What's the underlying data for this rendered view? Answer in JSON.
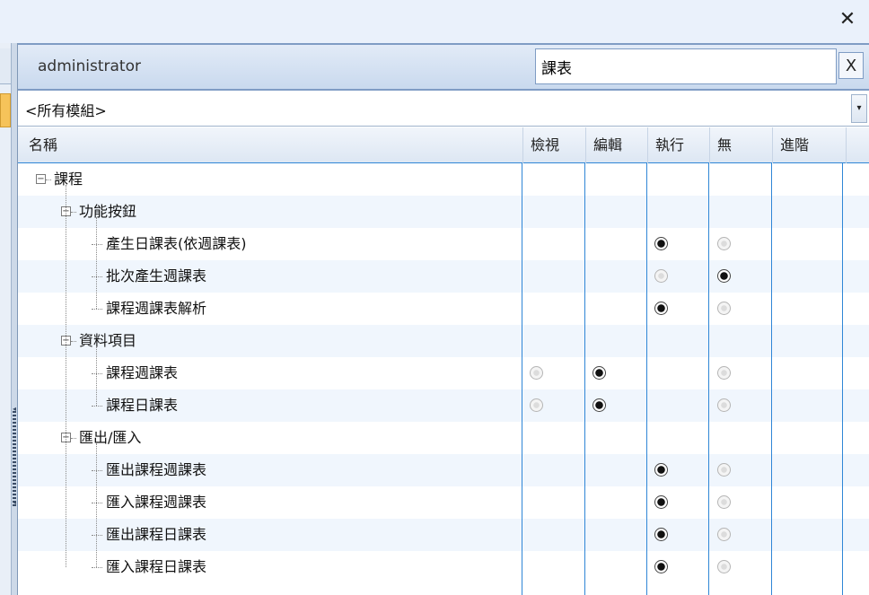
{
  "window": {
    "close_glyph": "✕"
  },
  "header": {
    "user": "administrator",
    "search_value": "課表",
    "clear_label": "X"
  },
  "module_filter": {
    "selected": "<所有模組>",
    "arrow": "▾"
  },
  "columns": {
    "name": "名稱",
    "view": "檢視",
    "edit": "編輯",
    "execute": "執行",
    "none": "無",
    "advanced": "進階"
  },
  "tree": [
    {
      "label": "課程",
      "level": 0,
      "expandable": true,
      "glyph": "⊟",
      "perm": []
    },
    {
      "label": "功能按鈕",
      "level": 1,
      "expandable": true,
      "glyph": "⊟",
      "perm": []
    },
    {
      "label": "產生日課表(依週課表)",
      "level": 2,
      "perm": [
        null,
        null,
        "on",
        "off",
        null
      ]
    },
    {
      "label": "批次產生週課表",
      "level": 2,
      "perm": [
        null,
        null,
        "off",
        "on",
        null
      ]
    },
    {
      "label": "課程週課表解析",
      "level": 2,
      "perm": [
        null,
        null,
        "on",
        "off",
        null
      ]
    },
    {
      "label": "資料項目",
      "level": 1,
      "expandable": true,
      "glyph": "⊟",
      "perm": []
    },
    {
      "label": "課程週課表",
      "level": 2,
      "perm": [
        "off",
        "on",
        null,
        "off",
        null
      ]
    },
    {
      "label": "課程日課表",
      "level": 2,
      "perm": [
        "off",
        "on",
        null,
        "off",
        null
      ]
    },
    {
      "label": "匯出/匯入",
      "level": 1,
      "expandable": true,
      "glyph": "⊟",
      "perm": []
    },
    {
      "label": "匯出課程週課表",
      "level": 2,
      "perm": [
        null,
        null,
        "on",
        "off",
        null
      ]
    },
    {
      "label": "匯入課程週課表",
      "level": 2,
      "perm": [
        null,
        null,
        "on",
        "off",
        null
      ]
    },
    {
      "label": "匯出課程日課表",
      "level": 2,
      "perm": [
        null,
        null,
        "on",
        "off",
        null
      ]
    },
    {
      "label": "匯入課程日課表",
      "level": 2,
      "perm": [
        null,
        null,
        "on",
        "off",
        null
      ]
    }
  ],
  "colors": {
    "accent": "#2f86d6",
    "header_bg": "#c9d9ee",
    "row_alt": "#f0f6fd",
    "tab_active": "#f6c35a"
  }
}
